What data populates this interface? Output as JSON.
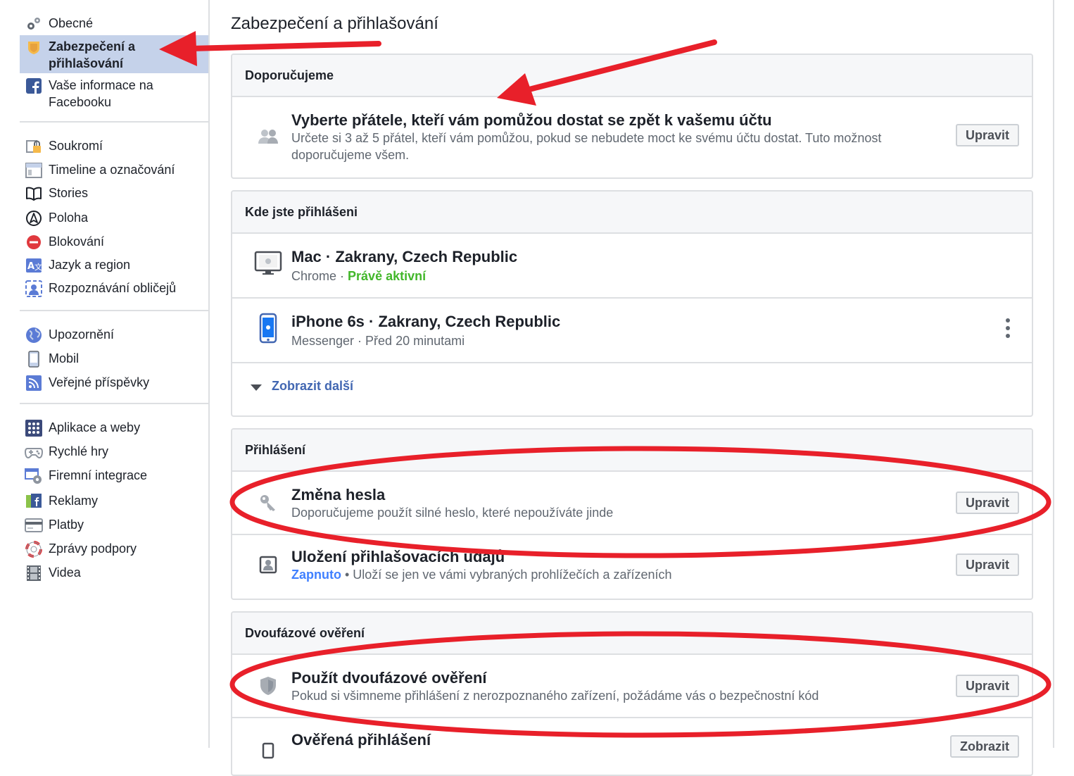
{
  "sidebar": {
    "groups": [
      [
        {
          "label": "Obecné",
          "icon": "gears-icon"
        },
        {
          "label": "Zabezpečení a přihlašování",
          "icon": "security-badge-icon",
          "active": true
        },
        {
          "label": "Vaše informace na Facebooku",
          "icon": "facebook-icon"
        }
      ],
      [
        {
          "label": "Soukromí",
          "icon": "privacy-lock-icon"
        },
        {
          "label": "Timeline a označování",
          "icon": "timeline-icon"
        },
        {
          "label": "Stories",
          "icon": "book-icon"
        },
        {
          "label": "Poloha",
          "icon": "location-icon"
        },
        {
          "label": "Blokování",
          "icon": "block-icon"
        },
        {
          "label": "Jazyk a region",
          "icon": "language-icon"
        },
        {
          "label": "Rozpoznávání obličejů",
          "icon": "face-recognition-icon"
        }
      ],
      [
        {
          "label": "Upozornění",
          "icon": "globe-icon"
        },
        {
          "label": "Mobil",
          "icon": "mobile-icon"
        },
        {
          "label": "Veřejné příspěvky",
          "icon": "rss-icon"
        }
      ],
      [
        {
          "label": "Aplikace a weby",
          "icon": "apps-icon"
        },
        {
          "label": "Rychlé hry",
          "icon": "gamepad-icon"
        },
        {
          "label": "Firemní integrace",
          "icon": "business-integration-icon"
        },
        {
          "label": "Reklamy",
          "icon": "ads-icon"
        },
        {
          "label": "Platby",
          "icon": "credit-card-icon"
        },
        {
          "label": "Zprávy podpory",
          "icon": "lifebuoy-icon"
        },
        {
          "label": "Videa",
          "icon": "film-icon"
        }
      ]
    ]
  },
  "main": {
    "title": "Zabezpečení a přihlašování",
    "recommended": {
      "header": "Doporučujeme",
      "title": "Vyberte přátele, kteří vám pomůžou dostat se zpět k vašemu účtu",
      "description": "Určete si 3 až 5 přátel, kteří vám pomůžou, pokud se nebudete moct ke svému účtu dostat. Tuto možnost doporučujeme všem.",
      "button": "Upravit"
    },
    "where_logged": {
      "header": "Kde jste přihlášeni",
      "sessions": [
        {
          "device": "Mac · Zakrany, Czech Republic",
          "app": "Chrome",
          "separator": " · ",
          "status": "Právě aktivní"
        },
        {
          "device": "iPhone 6s · Zakrany, Czech Republic",
          "app": "Messenger",
          "separator": " · ",
          "status": "Před 20 minutami"
        }
      ],
      "show_more": "Zobrazit další"
    },
    "login": {
      "header": "Přihlášení",
      "change_password": {
        "title": "Změna hesla",
        "description": "Doporučujeme použít silné heslo, které nepoužíváte jinde",
        "button": "Upravit"
      },
      "save_login": {
        "title": "Uložení přihlašovacích údajů",
        "status": "Zapnuto",
        "separator": " • ",
        "description": "Uloží se jen ve vámi vybraných prohlížečích a zařízeních",
        "button": "Upravit"
      }
    },
    "two_factor": {
      "header": "Dvoufázové ověření",
      "use_2fa": {
        "title": "Použít dvoufázové ověření",
        "description": "Pokud si všimneme přihlášení z nerozpoznaného zařízení, požádáme vás o bezpečnostní kód",
        "button": "Upravit"
      },
      "authorized_logins": {
        "title": "Ověřená přihlášení",
        "button": "Zobrazit"
      }
    }
  },
  "annotations": {
    "color": "#e8202a"
  }
}
